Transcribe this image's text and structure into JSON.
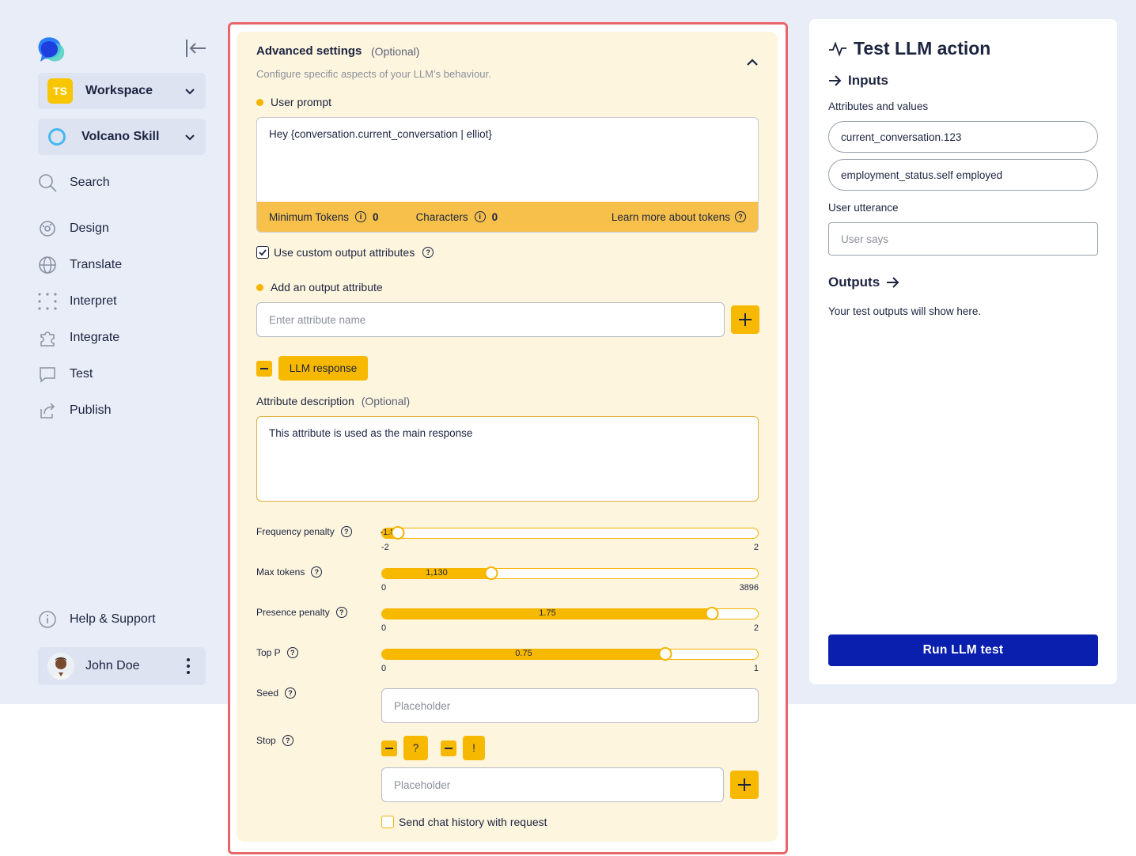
{
  "sidebar": {
    "workspace": {
      "badge": "TS",
      "label": "Workspace"
    },
    "skill": {
      "label": "Volcano Skill"
    },
    "nav": {
      "search": "Search",
      "design": "Design",
      "translate": "Translate",
      "interpret": "Interpret",
      "integrate": "Integrate",
      "test": "Test",
      "publish": "Publish"
    },
    "help": "Help & Support",
    "user": {
      "name": "John Doe"
    }
  },
  "advanced": {
    "title": "Advanced settings",
    "optional": "(Optional)",
    "subtitle": "Configure specific aspects of your LLM’s behaviour.",
    "user_prompt_label": "User prompt",
    "user_prompt_value": "Hey {conversation.current_conversation | elliot}",
    "min_tokens_label": "Minimum Tokens",
    "min_tokens_value": "0",
    "characters_label": "Characters",
    "characters_value": "0",
    "learn_more": "Learn more about tokens",
    "custom_output_label": "Use custom output attributes",
    "custom_output_checked": true,
    "add_output_label": "Add an output attribute",
    "attr_placeholder": "Enter attribute name",
    "attr_chip": "LLM response",
    "attr_desc_label": "Attribute description",
    "attr_desc_optional": "(Optional)",
    "attr_desc_value": "This attribute is used as the main response",
    "sliders": [
      {
        "label": "Frequency penalty",
        "value": -1.83,
        "display": "-1.83",
        "min": -2,
        "max": 2,
        "min_label": "-2",
        "max_label": "2"
      },
      {
        "label": "Max tokens",
        "value": 1130,
        "display": "1,130",
        "min": 0,
        "max": 3896,
        "min_label": "0",
        "max_label": "3896"
      },
      {
        "label": "Presence penalty",
        "value": 1.75,
        "display": "1.75",
        "min": 0,
        "max": 2,
        "min_label": "0",
        "max_label": "2"
      },
      {
        "label": "Top P",
        "value": 0.75,
        "display": "0.75",
        "min": 0,
        "max": 1,
        "min_label": "0",
        "max_label": "1"
      }
    ],
    "seed_label": "Seed",
    "seed_placeholder": "Placeholder",
    "stop_label": "Stop",
    "stop_chips": [
      "?",
      "!"
    ],
    "stop_placeholder": "Placeholder",
    "chat_history_label": "Send chat history with request",
    "chat_history_checked": false
  },
  "test_panel": {
    "title": "Test LLM action",
    "inputs_label": "Inputs",
    "attributes_label": "Attributes and values",
    "attributes": [
      "current_conversation.123",
      "employment_status.self employed"
    ],
    "utterance_label": "User utterance",
    "utterance_placeholder": "User says",
    "outputs_label": "Outputs",
    "outputs_empty": "Your test outputs will show here.",
    "run_button": "Run LLM test"
  },
  "colors": {
    "accent_yellow": "#f7b900",
    "run_button_blue": "#0a1fae",
    "highlight_border": "#e8666a",
    "sidebar_bg": "#e9edf7"
  }
}
